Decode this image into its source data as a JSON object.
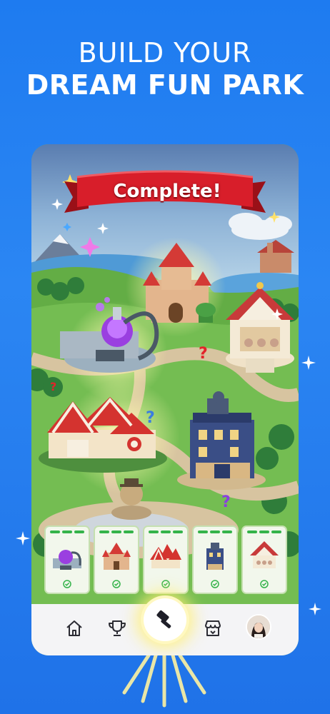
{
  "headline": {
    "line1": "BUILD YOUR",
    "line2": "DREAM FUN PARK"
  },
  "banner": {
    "text": "Complete!"
  },
  "attractions": [
    {
      "name": "science-lab"
    },
    {
      "name": "castle"
    },
    {
      "name": "circus-tent"
    },
    {
      "name": "haunted-hotel"
    },
    {
      "name": "carousel"
    }
  ],
  "nav": {
    "items": [
      "home-icon",
      "trophy-icon",
      "hammer-icon",
      "shop-icon",
      "avatar"
    ],
    "active": "hammer-icon"
  },
  "colors": {
    "background": "#1e7bf0",
    "banner": "#d81e2a",
    "progress": "#34b34a",
    "nav_bg": "#f4f4f6"
  }
}
